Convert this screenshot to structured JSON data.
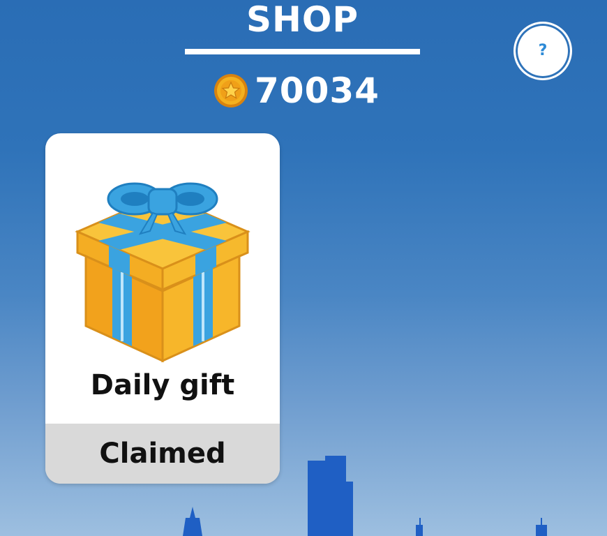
{
  "header": {
    "title": "SHOP",
    "help_label": "?"
  },
  "balance": {
    "icon": "coin-star-icon",
    "value": "70034"
  },
  "shop_items": [
    {
      "icon": "gift-box-icon",
      "title": "Daily gift",
      "status": "Claimed"
    }
  ],
  "colors": {
    "sky_top": "#2a6db5",
    "sky_bottom": "#9dbfe0",
    "skyline": "#1f5fc4",
    "text_white": "#ffffff",
    "card_bg": "#ffffff",
    "status_bg": "#d9d9d9",
    "help_accent": "#2d8ad6",
    "gift_yellow": "#f7b52c",
    "gift_ribbon": "#3aa3e0"
  }
}
